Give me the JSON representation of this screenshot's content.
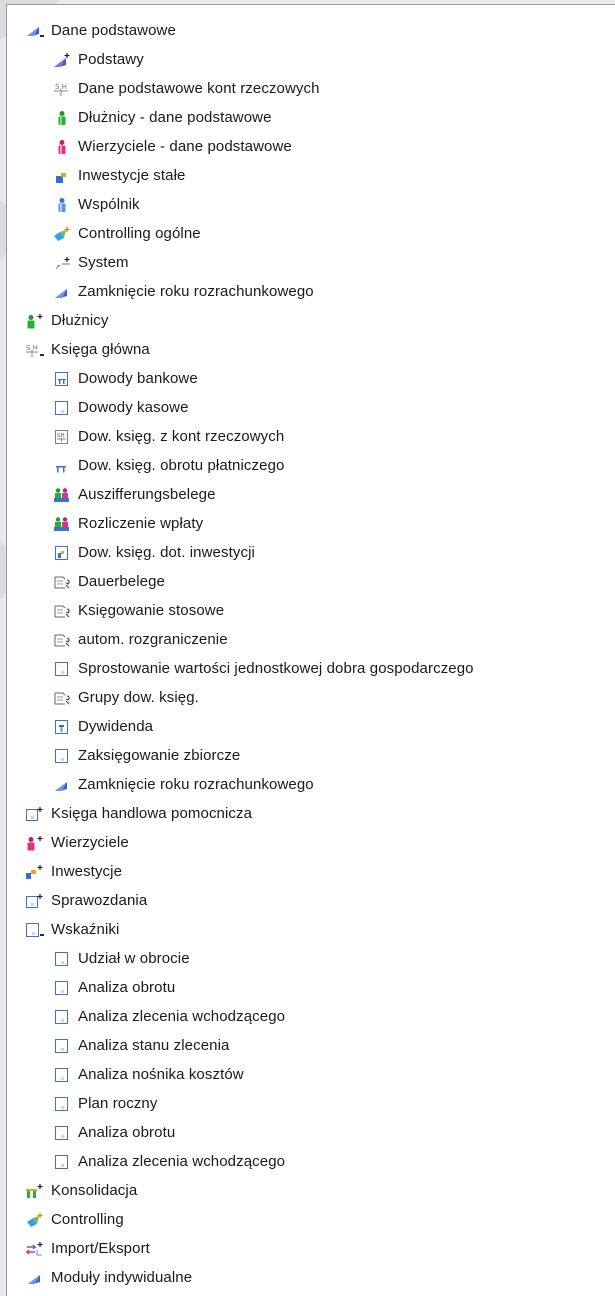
{
  "colors": {
    "panel_bg": "#ffffff",
    "text": "#1a1a1a",
    "border": "#9a9a9a",
    "page_bg": "#e9e9ec"
  },
  "tree": [
    {
      "label": "Dane podstawowe",
      "icon": "flag-folder-icon",
      "level": 0
    },
    {
      "label": "Podstawy",
      "icon": "flag-plus-icon",
      "level": 1
    },
    {
      "label": "Dane podstawowe kont rzeczowych",
      "icon": "ledger-sh-icon",
      "level": 1
    },
    {
      "label": "Dłużnicy - dane podstawowe",
      "icon": "green-person-icon",
      "level": 1
    },
    {
      "label": "Wierzyciele - dane podstawowe",
      "icon": "pink-person-icon",
      "level": 1
    },
    {
      "label": "Inwestycje stałe",
      "icon": "investment-icon",
      "level": 1
    },
    {
      "label": "Wspólnik",
      "icon": "blue-person-icon",
      "level": 1
    },
    {
      "label": "Controlling ogólne",
      "icon": "controlling-plus-icon",
      "level": 1
    },
    {
      "label": "System",
      "icon": "system-plus-icon",
      "level": 1
    },
    {
      "label": "Zamknięcie roku rozrachunkowego",
      "icon": "flag-icon",
      "level": 1
    },
    {
      "label": "Dłużnicy",
      "icon": "green-person-plus-icon",
      "level": 0
    },
    {
      "label": "Księga główna",
      "icon": "ledger-folder-icon",
      "level": 0
    },
    {
      "label": "Dowody bankowe",
      "icon": "bank-document-icon",
      "level": 1
    },
    {
      "label": "Dowody kasowe",
      "icon": "document-icon",
      "level": 1
    },
    {
      "label": "Dow. księg. z kont rzeczowych",
      "icon": "ledger-document-icon",
      "level": 1
    },
    {
      "label": "Dow. księg. obrotu płatniczego",
      "icon": "payment-icon",
      "level": 1
    },
    {
      "label": "Auszifferungsbelege",
      "icon": "people-pair-icon",
      "level": 1
    },
    {
      "label": "Rozliczenie wpłaty",
      "icon": "people-pair-icon",
      "level": 1
    },
    {
      "label": "Dow. księg. dot. inwestycji",
      "icon": "investment-document-icon",
      "level": 1
    },
    {
      "label": "Dauerbelege",
      "icon": "recurring-document-icon",
      "level": 1
    },
    {
      "label": "Księgowanie stosowe",
      "icon": "recurring-document-icon",
      "level": 1
    },
    {
      "label": "autom. rozgraniczenie",
      "icon": "recurring-document-icon",
      "level": 1
    },
    {
      "label": "Sprostowanie wartości jednostkowej dobra gospodarczego",
      "icon": "document-icon",
      "level": 1
    },
    {
      "label": "Grupy dow. księg.",
      "icon": "recurring-document-icon",
      "level": 1
    },
    {
      "label": "Dywidenda",
      "icon": "dividend-document-icon",
      "level": 1
    },
    {
      "label": "Zaksięgowanie zbiorcze",
      "icon": "document-icon",
      "level": 1
    },
    {
      "label": "Zamknięcie roku rozrachunkowego",
      "icon": "flag-icon",
      "level": 1
    },
    {
      "label": "Księga handlowa pomocnicza",
      "icon": "document-plus-icon",
      "level": 0
    },
    {
      "label": "Wierzyciele",
      "icon": "pink-person-plus-icon",
      "level": 0
    },
    {
      "label": "Inwestycje",
      "icon": "investment-plus-icon",
      "level": 0
    },
    {
      "label": "Sprawozdania",
      "icon": "document-plus-icon",
      "level": 0
    },
    {
      "label": "Wskaźniki",
      "icon": "document-folder-icon",
      "level": 0
    },
    {
      "label": "Udział w obrocie",
      "icon": "document-icon",
      "level": 1
    },
    {
      "label": "Analiza obrotu",
      "icon": "document-icon",
      "level": 1
    },
    {
      "label": "Analiza zlecenia wchodzącego",
      "icon": "document-icon",
      "level": 1
    },
    {
      "label": "Analiza stanu zlecenia",
      "icon": "document-icon",
      "level": 1
    },
    {
      "label": "Analiza nośnika kosztów",
      "icon": "document-icon",
      "level": 1
    },
    {
      "label": "Plan roczny",
      "icon": "document-icon",
      "level": 1
    },
    {
      "label": "Analiza obrotu",
      "icon": "document-icon",
      "level": 1
    },
    {
      "label": "Analiza zlecenia wchodzącego",
      "icon": "document-icon",
      "level": 1
    },
    {
      "label": "Konsolidacja",
      "icon": "consolidation-plus-icon",
      "level": 0
    },
    {
      "label": "Controlling",
      "icon": "controlling-plus-icon",
      "level": 0
    },
    {
      "label": "Import/Eksport",
      "icon": "import-export-plus-icon",
      "level": 0
    },
    {
      "label": "Moduły indywidualne",
      "icon": "flag-icon",
      "level": 0
    }
  ]
}
